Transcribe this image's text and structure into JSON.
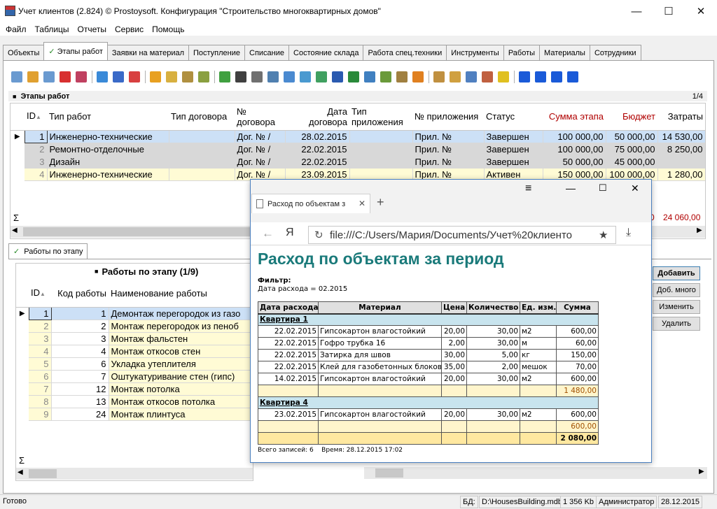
{
  "window": {
    "title": "Учет клиентов (2.824) © Prostoysoft. Конфигурация \"Строительство многоквартирных домов\"",
    "min": "—",
    "max": "☐",
    "close": "✕"
  },
  "menu": [
    "Файл",
    "Таблицы",
    "Отчеты",
    "Сервис",
    "Помощь"
  ],
  "tabs": [
    "Объекты",
    "Этапы работ",
    "Заявки на материал",
    "Поступление",
    "Списание",
    "Состояние склада",
    "Работа спец.техники",
    "Инструменты",
    "Работы",
    "Материалы",
    "Сотрудники"
  ],
  "active_tab_check": "✓",
  "stages": {
    "title": "Этапы работ",
    "counter": "1/4",
    "headers": {
      "id": "ID",
      "type": "Тип работ",
      "contract_type": "Тип договора",
      "contract_no": "№ договора",
      "date": "Дата договора",
      "app_type": "Тип приложения",
      "app_no": "№ приложения",
      "status": "Статус",
      "sum": "Сумма этапа",
      "budget": "Бюджет",
      "costs": "Затраты"
    },
    "rows": [
      {
        "id": "1",
        "type": "Инженерно-технические",
        "contract_type": "",
        "contract_no": "Дог. № /",
        "date": "28.02.2015",
        "app_type": "",
        "app_no": "Прил. №",
        "status": "Завершен",
        "sum": "100 000,00",
        "budget": "50 000,00",
        "costs": "14 530,00"
      },
      {
        "id": "2",
        "type": "Ремонтно-отделочные",
        "contract_type": "",
        "contract_no": "Дог. № /",
        "date": "22.02.2015",
        "app_type": "",
        "app_no": "Прил. №",
        "status": "Завершен",
        "sum": "100 000,00",
        "budget": "75 000,00",
        "costs": "8 250,00"
      },
      {
        "id": "3",
        "type": "Дизайн",
        "contract_type": "",
        "contract_no": "Дог. № /",
        "date": "22.02.2015",
        "app_type": "",
        "app_no": "Прил. №",
        "status": "Завершен",
        "sum": "50 000,00",
        "budget": "45 000,00",
        "costs": ""
      },
      {
        "id": "4",
        "type": "Инженерно-технические",
        "contract_type": "",
        "contract_no": "Дог. № /",
        "date": "23.09.2015",
        "app_type": "",
        "app_no": "Прил. №",
        "status": "Активен",
        "sum": "150 000,00",
        "budget": "100 000,00",
        "costs": "1 280,00"
      }
    ],
    "sigma": "Σ",
    "total_budget_partial": "0",
    "total_costs": "24 060,00"
  },
  "works": {
    "tab": "Работы по этапу",
    "title": "Работы по этапу (1/9)",
    "headers": {
      "id": "ID",
      "code": "Код работы",
      "name": "Наименование работы"
    },
    "rows": [
      {
        "id": "1",
        "code": "1",
        "name": "Демонтаж перегородок из газо"
      },
      {
        "id": "2",
        "code": "2",
        "name": "Монтаж перегородок из пеноб"
      },
      {
        "id": "3",
        "code": "3",
        "name": "Монтаж фальстен"
      },
      {
        "id": "4",
        "code": "4",
        "name": "Монтаж откосов стен"
      },
      {
        "id": "5",
        "code": "6",
        "name": "Укладка утеплителя"
      },
      {
        "id": "6",
        "code": "7",
        "name": "Оштукатуривание стен (гипс)"
      },
      {
        "id": "7",
        "code": "12",
        "name": "Монтаж потолка"
      },
      {
        "id": "8",
        "code": "13",
        "name": "Монтаж откосов потолка"
      },
      {
        "id": "9",
        "code": "24",
        "name": "Монтаж плинтуса"
      }
    ],
    "sigma": "Σ"
  },
  "buttons": {
    "add": "Добавить",
    "add_many": "Доб. много",
    "edit": "Изменить",
    "delete": "Удалить"
  },
  "browser": {
    "tab_title": "Расход по объектам з",
    "url": "file:///C:/Users/Мария/Documents/Учет%20клиенто",
    "report": {
      "title": "Расход по объектам за период",
      "filter_label": "Фильтр:",
      "filter_value": "Дата расхода = 02.2015",
      "headers": [
        "Дата расхода",
        "Материал",
        "Цена",
        "Количество",
        "Ед. изм.",
        "Сумма"
      ],
      "groups": [
        {
          "name": "Квартира 1",
          "rows": [
            [
              "22.02.2015",
              "Гипсокартон влагостойкий",
              "20,00",
              "30,00",
              "м2",
              "600,00"
            ],
            [
              "22.02.2015",
              "Гофро трубка 16",
              "2,00",
              "30,00",
              "м",
              "60,00"
            ],
            [
              "22.02.2015",
              "Затирка для швов",
              "30,00",
              "5,00",
              "кг",
              "150,00"
            ],
            [
              "22.02.2015",
              "Клей для газобетонных блоков",
              "35,00",
              "2,00",
              "мешок",
              "70,00"
            ],
            [
              "14.02.2015",
              "Гипсокартон влагостойкий",
              "20,00",
              "30,00",
              "м2",
              "600,00"
            ]
          ],
          "subtotal": "1 480,00"
        },
        {
          "name": "Квартира 4",
          "rows": [
            [
              "23.02.2015",
              "Гипсокартон влагостойкий",
              "20,00",
              "30,00",
              "м2",
              "600,00"
            ]
          ],
          "subtotal": "600,00"
        }
      ],
      "total": "2 080,00",
      "footer": "Всего записей: 6    Время: 28.12.2015 17:02"
    }
  },
  "status": {
    "ready": "Готово",
    "db_label": "БД:",
    "db_file": "D:\\HousesBuilding.mdb",
    "size": "1 356 Kb",
    "user": "Администратор",
    "date": "28.12.2015"
  }
}
